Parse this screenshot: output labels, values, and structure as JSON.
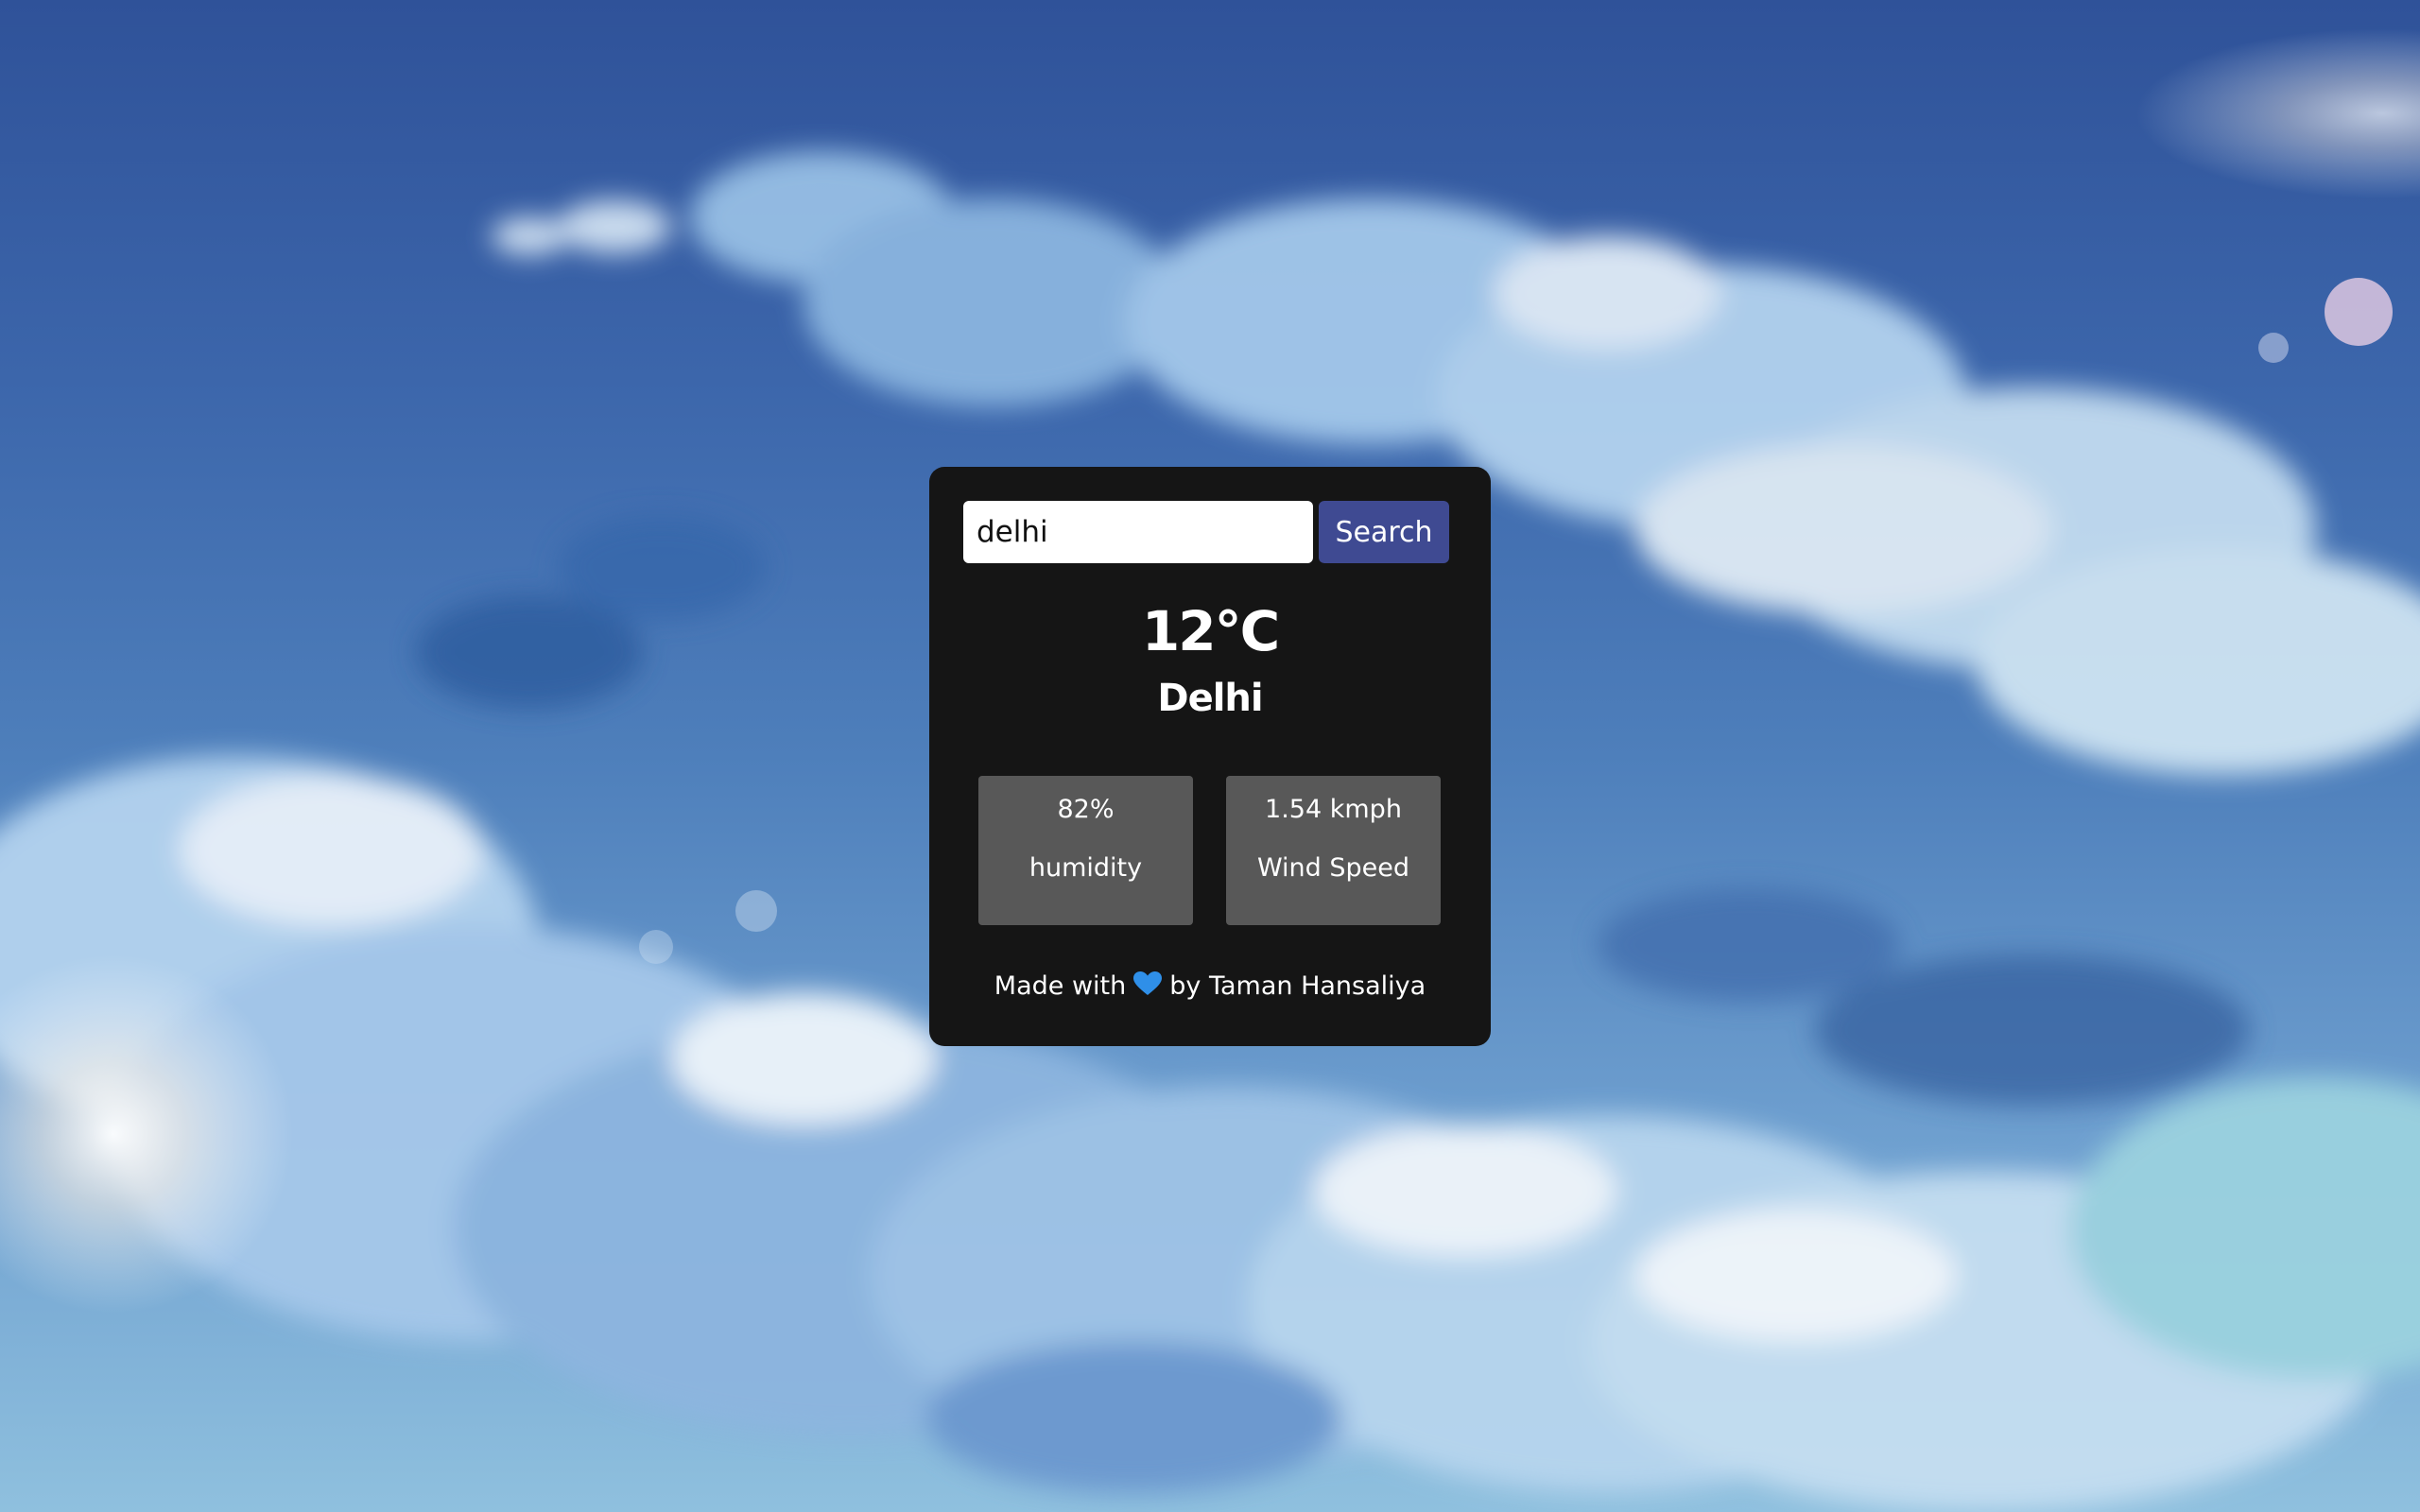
{
  "search": {
    "value": "delhi",
    "button_label": "Search"
  },
  "weather": {
    "temperature": "12°C",
    "city": "Delhi",
    "humidity_value": "82%",
    "humidity_label": "humidity",
    "wind_value": "1.54 kmph",
    "wind_label": "Wind Speed"
  },
  "footer": {
    "made_with": "Made with",
    "icon": "heart-icon",
    "author": "by Taman Hansaliya"
  },
  "colors": {
    "card_background": "#151515",
    "search_button": "#3f4a92",
    "stat_box": "#585858",
    "heart": "#2f8fe8"
  }
}
